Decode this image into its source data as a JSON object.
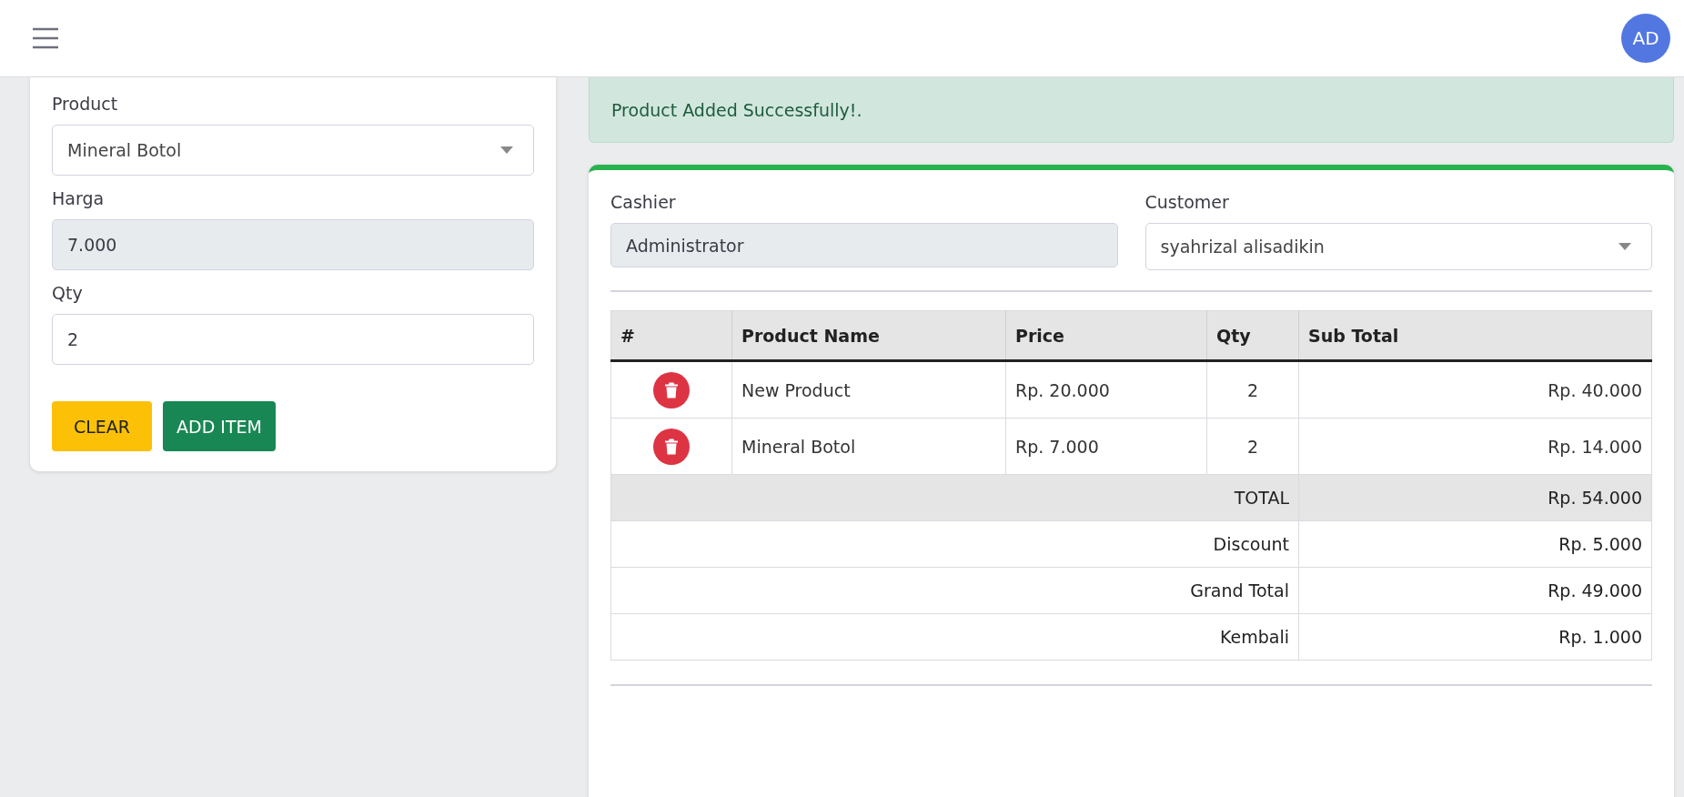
{
  "navbar": {
    "avatar": "AD"
  },
  "item_form": {
    "fields": [
      {
        "label": "Product",
        "kind": "select",
        "value": "Mineral Botol"
      },
      {
        "label": "Harga",
        "kind": "readonly",
        "value": "7.000"
      },
      {
        "label": "Qty",
        "kind": "input",
        "value": "2"
      }
    ],
    "buttons": [
      {
        "label": "CLEAR",
        "kind": "warning"
      },
      {
        "label": "ADD ITEM",
        "kind": "success"
      }
    ]
  },
  "alert": {
    "message": "Product Added Successfully!."
  },
  "sale": {
    "cashier": {
      "label": "Cashier",
      "value": "Administrator"
    },
    "customer": {
      "label": "Customer",
      "value": "syahrizal alisadikin"
    },
    "table": {
      "columns": [
        "#",
        "Product Name",
        "Price",
        "Qty",
        "Sub Total"
      ],
      "rows": [
        {
          "product": "New Product",
          "price": "Rp. 20.000",
          "qty": "2",
          "subtotal": "Rp. 40.000"
        },
        {
          "product": "Mineral Botol",
          "price": "Rp. 7.000",
          "qty": "2",
          "subtotal": "Rp. 14.000"
        }
      ],
      "summary": [
        {
          "label": "TOTAL",
          "value": "Rp. 54.000",
          "highlighted": true
        },
        {
          "label": "Discount",
          "value": "Rp. 5.000",
          "highlighted": false
        },
        {
          "label": "Grand Total",
          "value": "Rp. 49.000",
          "highlighted": false
        },
        {
          "label": "Kembali",
          "value": "Rp. 1.000",
          "highlighted": false
        }
      ]
    }
  }
}
